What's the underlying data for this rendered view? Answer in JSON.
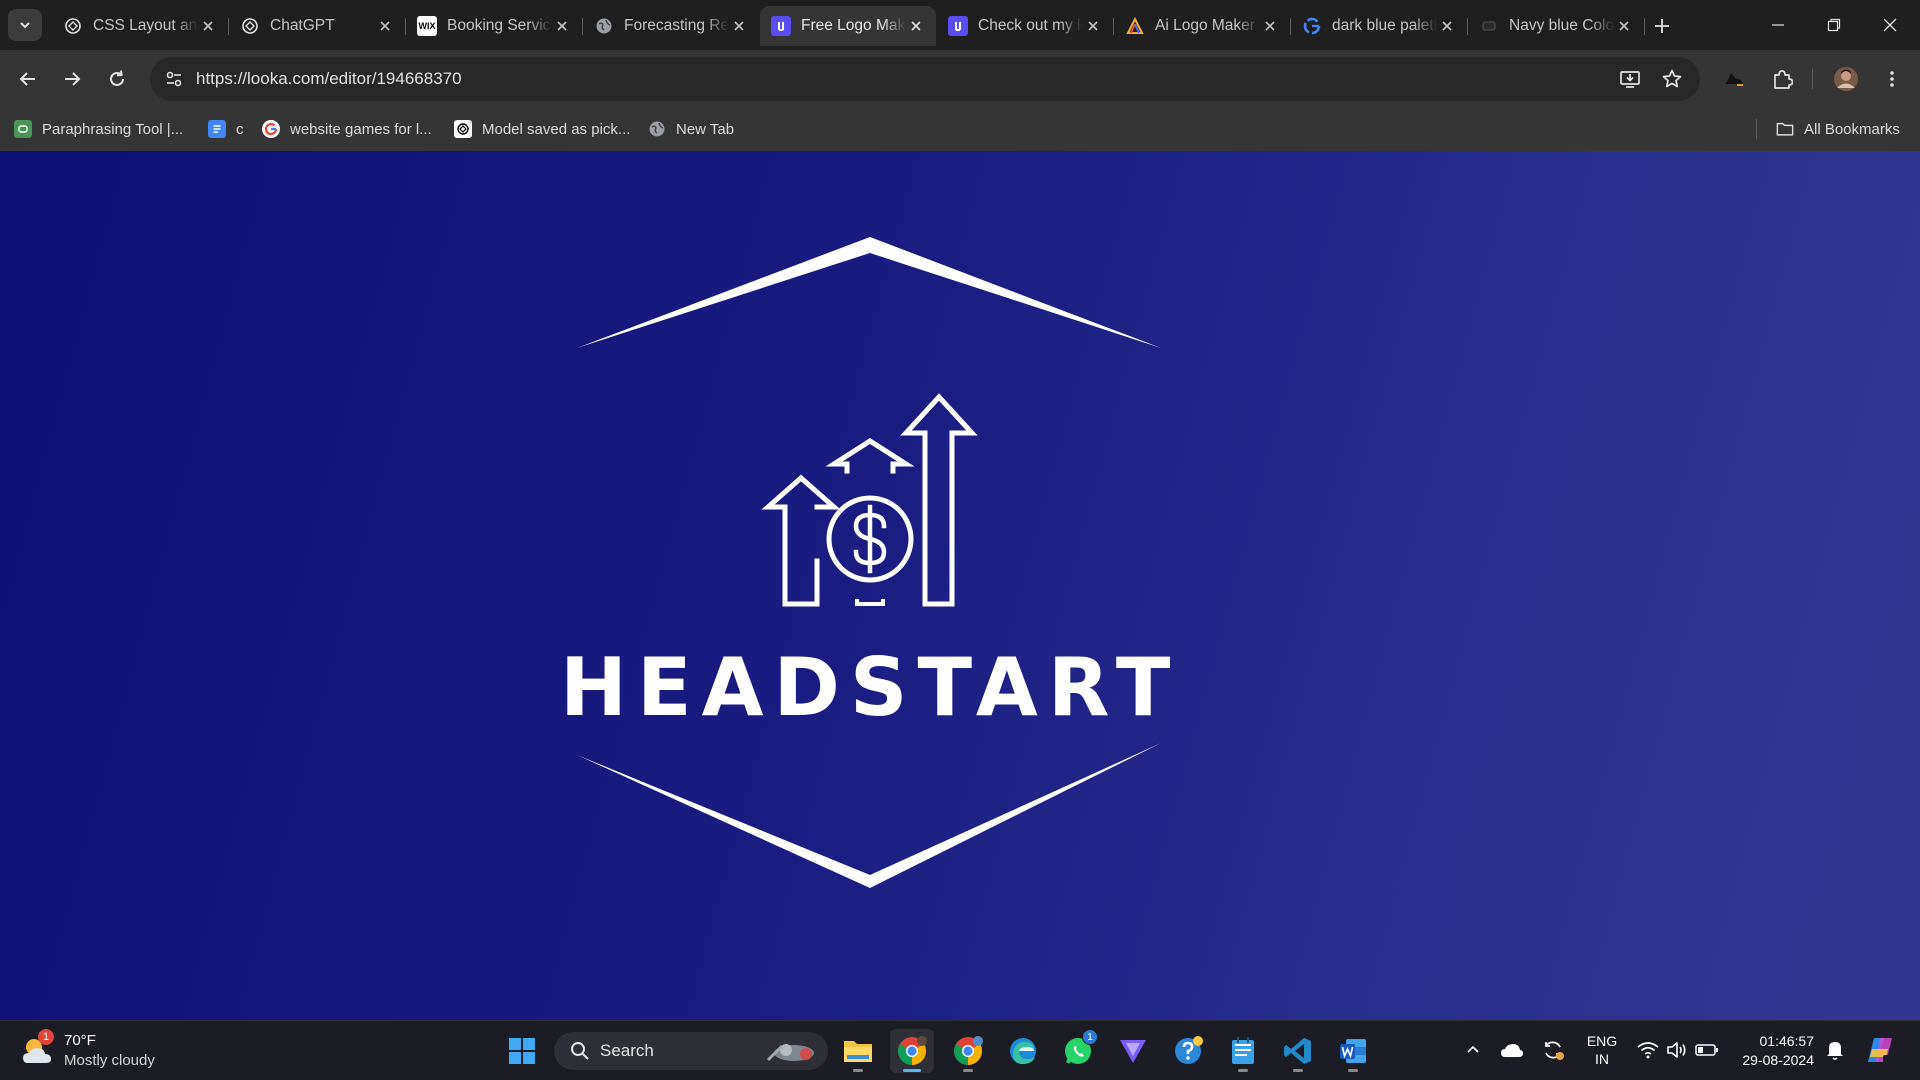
{
  "browser": {
    "tabs": [
      {
        "title": "CSS Layout and Styling",
        "favicon": "chatgpt-icon",
        "active": false
      },
      {
        "title": "ChatGPT",
        "favicon": "chatgpt-icon",
        "active": false
      },
      {
        "title": "Booking Services",
        "favicon": "wix-icon",
        "active": false
      },
      {
        "title": "Forecasting Results",
        "favicon": "globe-icon",
        "active": false
      },
      {
        "title": "Free Logo Maker",
        "favicon": "looka-icon",
        "active": true
      },
      {
        "title": "Check out my logo",
        "favicon": "looka-icon",
        "active": false
      },
      {
        "title": "Ai Logo Maker",
        "favicon": "logo-maker-icon",
        "active": false
      },
      {
        "title": "dark blue palette",
        "favicon": "google-icon",
        "active": false
      },
      {
        "title": "Navy blue Color",
        "favicon": "site-icon",
        "active": false
      }
    ],
    "url": "https://looka.com/editor/194668370",
    "bookmarks": [
      {
        "label": "Paraphrasing Tool |...",
        "favicon": "quillbot-icon"
      },
      {
        "label": "c",
        "favicon": "docs-icon"
      },
      {
        "label": "website games for l...",
        "favicon": "google-icon"
      },
      {
        "label": "Model saved as pick...",
        "favicon": "chatgpt-icon"
      },
      {
        "label": "New Tab",
        "favicon": "globe-icon"
      }
    ],
    "all_bookmarks_label": "All Bookmarks"
  },
  "logo": {
    "brand_name": "HEADSTART",
    "emblem": "growth-arrows-dollar-icon",
    "frame": "hexagon-chevrons",
    "color": "#ffffff",
    "background_gradient": [
      "#0d0f75",
      "#33378f"
    ]
  },
  "taskbar": {
    "weather": {
      "temp": "70°F",
      "condition": "Mostly cloudy",
      "badge": "1"
    },
    "search_label": "Search",
    "apps": [
      {
        "name": "file-explorer",
        "badge": ""
      },
      {
        "name": "chrome",
        "badge": ""
      },
      {
        "name": "chrome-profile",
        "badge": ""
      },
      {
        "name": "edge",
        "badge": ""
      },
      {
        "name": "whatsapp",
        "badge": "1"
      },
      {
        "name": "vpn",
        "badge": ""
      },
      {
        "name": "get-help",
        "badge": ""
      },
      {
        "name": "notepad",
        "badge": ""
      },
      {
        "name": "vscode",
        "badge": ""
      },
      {
        "name": "word",
        "badge": ""
      }
    ],
    "language": {
      "line1": "ENG",
      "line2": "IN"
    },
    "time": "01:46:57",
    "date": "29-08-2024"
  }
}
